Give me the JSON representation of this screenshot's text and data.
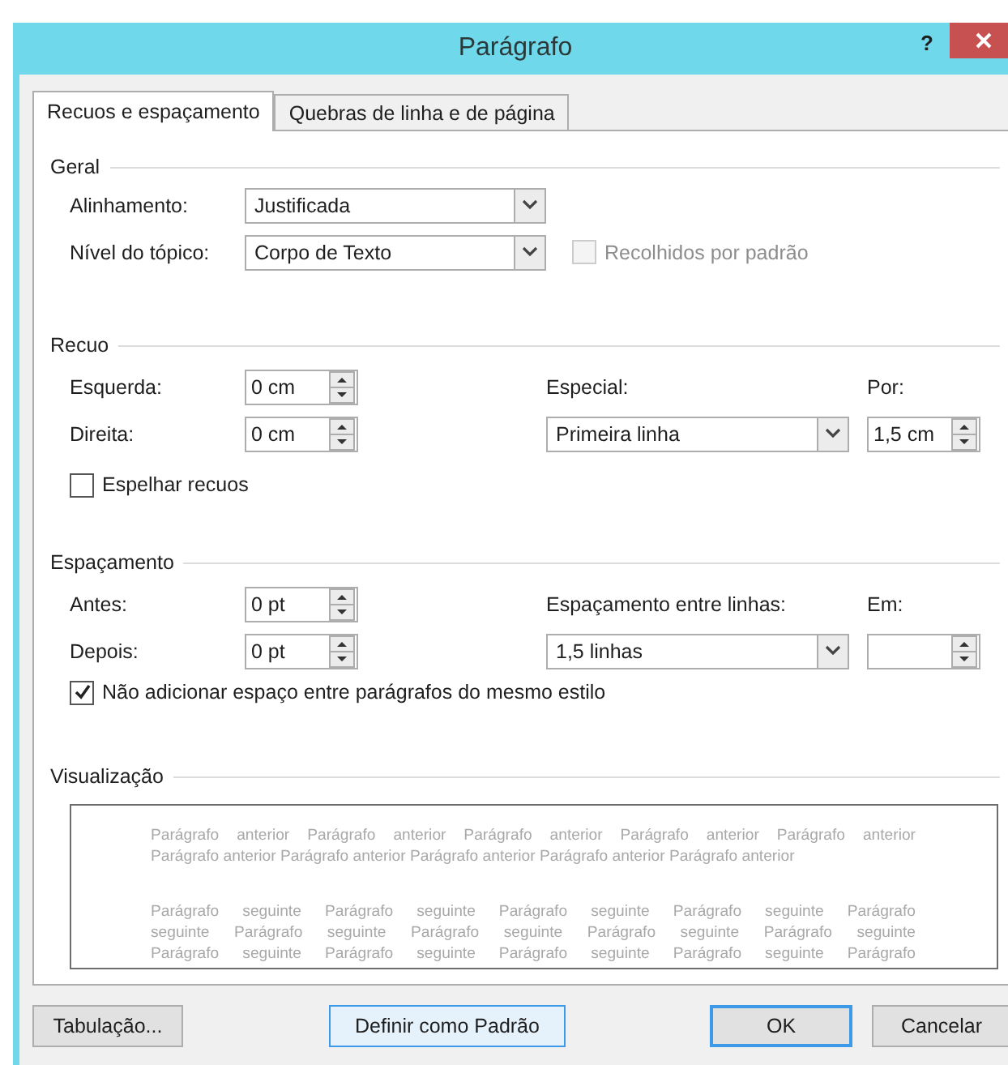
{
  "window": {
    "title": "Parágrafo",
    "help": "?"
  },
  "tabs": [
    {
      "label": "Recuos e espaçamento",
      "selected": true
    },
    {
      "label": "Quebras de linha e de página",
      "selected": false
    }
  ],
  "general": {
    "heading": "Geral",
    "alignment": {
      "label": "Alinhamento:",
      "value": "Justificada"
    },
    "outline_level": {
      "label": "Nível do tópico:",
      "value": "Corpo de Texto"
    },
    "collapsed": {
      "label": "Recolhidos por padrão",
      "checked": false,
      "disabled": true
    }
  },
  "indent": {
    "heading": "Recuo",
    "left": {
      "label": "Esquerda:",
      "value": "0 cm"
    },
    "right": {
      "label": "Direita:",
      "value": "0 cm"
    },
    "special": {
      "label": "Especial:",
      "value": "Primeira linha"
    },
    "by": {
      "label": "Por:",
      "value": "1,5 cm"
    },
    "mirror": {
      "label": "Espelhar recuos",
      "checked": false,
      "disabled": false
    }
  },
  "spacing": {
    "heading": "Espaçamento",
    "before": {
      "label": "Antes:",
      "value": "0 pt"
    },
    "after": {
      "label": "Depois:",
      "value": "0 pt"
    },
    "line_spacing": {
      "label": "Espaçamento entre linhas:",
      "value": "1,5 linhas"
    },
    "at": {
      "label": "Em:"
    },
    "no_space": {
      "label": "Não adicionar espaço entre parágrafos do mesmo estilo",
      "checked": true,
      "disabled": false
    }
  },
  "preview": {
    "heading": "Visualização",
    "paragraphs": [
      {
        "kind": "previous",
        "lines": [
          "Parágrafo anterior Parágrafo anterior Parágrafo anterior Parágrafo anterior Parágrafo anterior",
          "Parágrafo anterior Parágrafo anterior Parágrafo anterior Parágrafo anterior Parágrafo anterior"
        ]
      },
      {
        "kind": "following",
        "lines": [
          "Parágrafo seguinte Parágrafo seguinte Parágrafo seguinte Parágrafo seguinte Parágrafo",
          "seguinte Parágrafo seguinte Parágrafo seguinte Parágrafo seguinte Parágrafo seguinte",
          "Parágrafo seguinte Parágrafo seguinte Parágrafo seguinte Parágrafo seguinte Parágrafo"
        ]
      }
    ]
  },
  "buttons": [
    {
      "label": "Tabulação...",
      "highlighted": false,
      "default": false
    },
    {
      "label": "Definir como Padrão",
      "highlighted": true,
      "default": false
    },
    {
      "label": "OK",
      "highlighted": false,
      "default": true
    },
    {
      "label": "Cancelar",
      "highlighted": false,
      "default": false
    }
  ]
}
